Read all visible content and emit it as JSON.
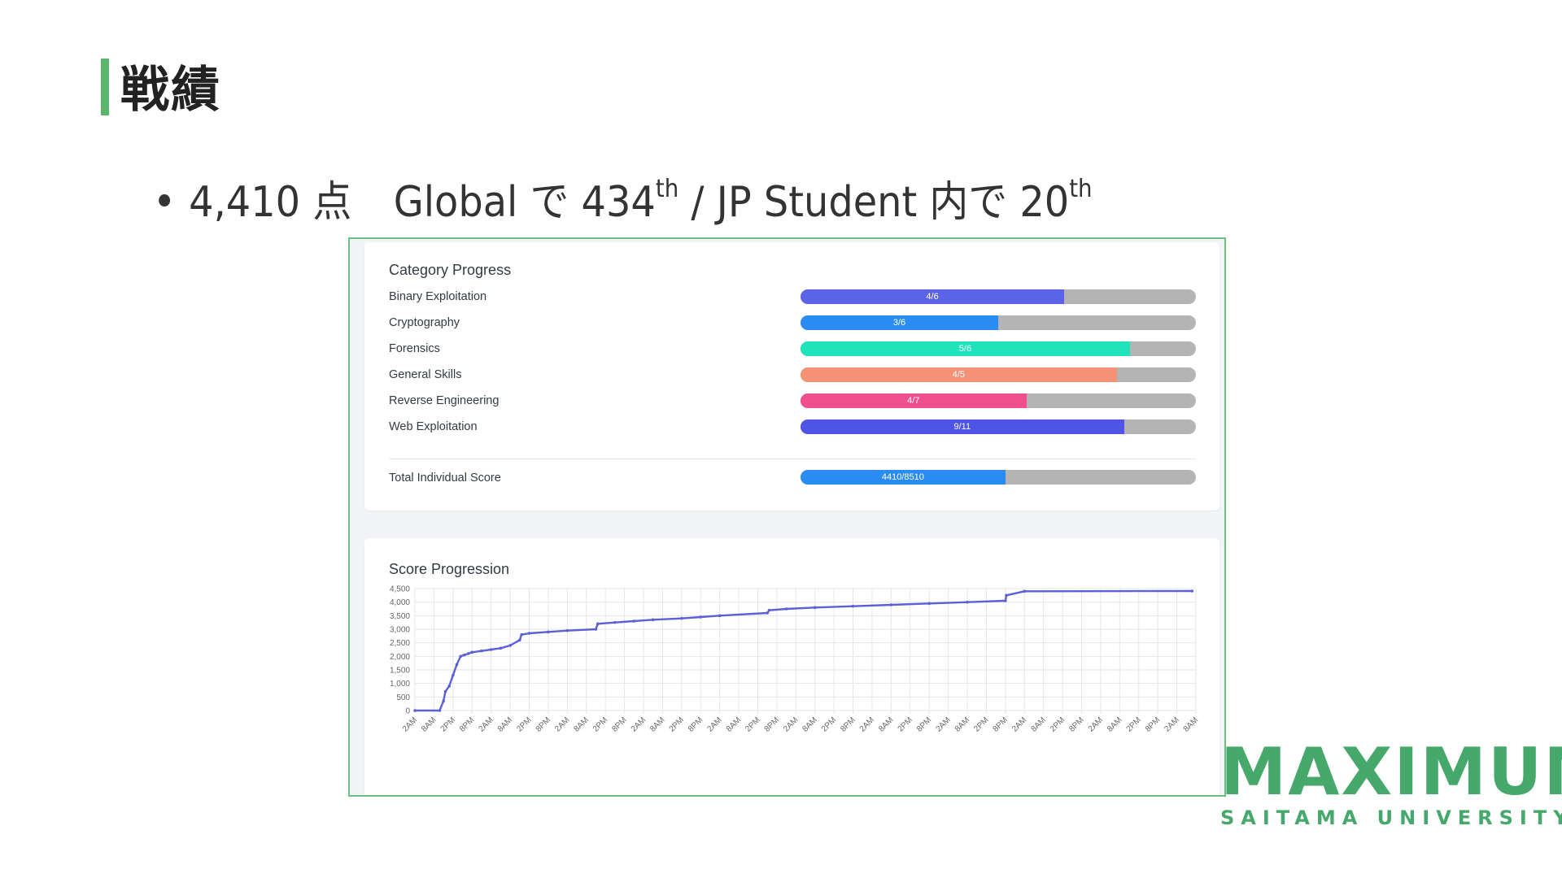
{
  "slide": {
    "title": "戦績",
    "bullet": {
      "dot": "•",
      "score": "4,410 点",
      "global_prefix": "Global で 434",
      "global_suffix": "th",
      "separator": " / JP Student 内で 20",
      "jp_suffix": "th"
    }
  },
  "category_progress": {
    "title": "Category Progress",
    "rows": [
      {
        "label": "Binary Exploitation",
        "text": "4/6",
        "fraction": 0.667,
        "color": "#5b63e8"
      },
      {
        "label": "Cryptography",
        "text": "3/6",
        "fraction": 0.5,
        "color": "#2a8cf3"
      },
      {
        "label": "Forensics",
        "text": "5/6",
        "fraction": 0.833,
        "color": "#1fe3bb"
      },
      {
        "label": "General Skills",
        "text": "4/5",
        "fraction": 0.8,
        "color": "#f59276"
      },
      {
        "label": "Reverse Engineering",
        "text": "4/7",
        "fraction": 0.571,
        "color": "#f04f8d"
      },
      {
        "label": "Web Exploitation",
        "text": "9/11",
        "fraction": 0.818,
        "color": "#4e54e6"
      }
    ],
    "total": {
      "label": "Total Individual Score",
      "text": "4410/8510",
      "fraction": 0.518,
      "color": "#2a8cf3"
    }
  },
  "chart_data": {
    "type": "line",
    "title": "Score Progression",
    "ylim": [
      0,
      4500
    ],
    "yticks": [
      0,
      500,
      1000,
      1500,
      2000,
      2500,
      3000,
      3500,
      4000,
      4500
    ],
    "ytick_labels": [
      "0",
      "500",
      "1,000",
      "1,500",
      "2,000",
      "2,500",
      "3,000",
      "3,500",
      "4,000",
      "4,500"
    ],
    "xtick_labels": [
      "2AM",
      "8AM",
      "2PM",
      "8PM",
      "2AM",
      "8AM",
      "2PM",
      "8PM",
      "2AM",
      "8AM",
      "2PM",
      "8PM",
      "2AM",
      "8AM",
      "2PM",
      "8PM",
      "2AM",
      "8AM",
      "2PM",
      "8PM",
      "2AM",
      "8AM",
      "2PM",
      "8PM",
      "2AM",
      "8AM",
      "2PM",
      "8PM",
      "2AM",
      "8AM",
      "2PM",
      "8PM",
      "2AM",
      "8AM",
      "2PM",
      "8PM",
      "2AM",
      "8AM",
      "2PM",
      "8PM",
      "2AM",
      "8AM"
    ],
    "grid": true,
    "color": "#5a60d8",
    "series": [
      {
        "x": [
          0,
          1.3,
          1.5,
          1.6,
          1.8,
          2.0,
          2.2,
          2.4,
          2.6,
          2.8,
          3.0,
          3.5,
          4.0,
          4.5,
          5.0,
          5.5,
          5.6,
          6.0,
          7.0,
          8.0,
          9.5,
          9.6,
          10.5,
          11.5,
          12.5,
          14.0,
          15.0,
          16.0,
          18.5,
          18.6,
          19.5,
          21.0,
          23.0,
          25.0,
          27.0,
          29.0,
          31.0,
          31.05,
          32.0,
          40.8
        ],
        "y": [
          0,
          0,
          350,
          700,
          900,
          1300,
          1700,
          2000,
          2050,
          2100,
          2150,
          2200,
          2250,
          2300,
          2400,
          2600,
          2800,
          2850,
          2900,
          2950,
          3000,
          3200,
          3250,
          3300,
          3350,
          3400,
          3450,
          3500,
          3600,
          3700,
          3750,
          3800,
          3850,
          3900,
          3950,
          4000,
          4050,
          4250,
          4400,
          4410
        ]
      }
    ]
  },
  "logo": {
    "word": "MAXIMUM",
    "sub": "SAITAMA UNIVERSITY"
  }
}
